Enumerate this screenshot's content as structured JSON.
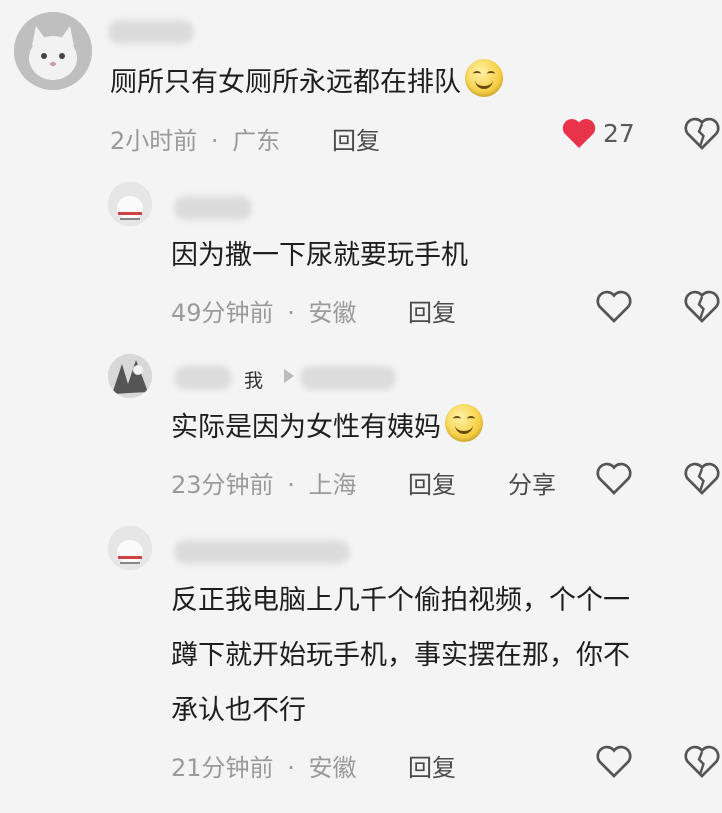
{
  "comments": [
    {
      "text": "厕所只有女厕所永远都在排队",
      "time": "2小时前",
      "location": "广东",
      "reply_label": "回复",
      "like_count": "27",
      "liked": true
    },
    {
      "text": "因为撒一下尿就要玩手机",
      "time": "49分钟前",
      "location": "安徽",
      "reply_label": "回复"
    },
    {
      "me_label": "我",
      "text": "实际是因为女性有姨妈",
      "time": "23分钟前",
      "location": "上海",
      "reply_label": "回复",
      "share_label": "分享"
    },
    {
      "text_lines": [
        "反正我电脑上几千个偷拍视频，个个一",
        "蹲下就开始玩手机，事实摆在那，你不",
        "承认也不行"
      ],
      "time": "21分钟前",
      "location": "安徽",
      "reply_label": "回复"
    }
  ],
  "separator": "·",
  "colors": {
    "liked_heart": "#e8334a",
    "meta_text": "#9a9a9a",
    "icon_stroke": "#555555"
  }
}
